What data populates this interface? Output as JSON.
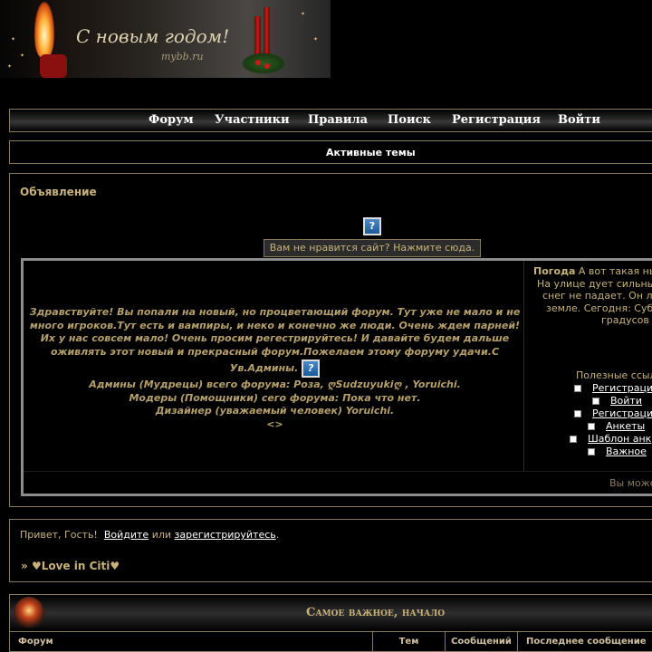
{
  "banner": {
    "greeting": "С новым годом!",
    "subtitle": "mybb.ru"
  },
  "nav": {
    "items": [
      "Форум",
      "Участники",
      "Правила",
      "Поиск",
      "Регистрация",
      "Войти"
    ]
  },
  "active_topics": "Активные темы",
  "announcement": {
    "title": "Объявление",
    "tooltip": "Вам не нравится сайт? Нажмите сюда.",
    "welcome_lines": [
      "Здравствуйте! Вы попали на новый, но процветающий форум. Тут уже не мало и не",
      "много игроков.Тут есть и вампиры, и неко и конечно же люди. Очень ждем парней!",
      "Их у нас совсем мало! Очень просим регестрируйтесь! И давайте будем дальше",
      "оживлять этот новый и прекрасный форум.Пожелаем этому форуму удачи.С",
      "Ув.Админы.",
      "Админы (Мудрецы) всего форума: Роза, ღSudzuyukiღ , Yoruichi.",
      "Модеры (Помощники) сего форума: Пока что нет.",
      "Дизайнер (уважаемый человек) Yoruichi.",
      "<>"
    ],
    "weather": {
      "label": "Погода",
      "lines": [
        "А вот такая ны",
        "На улице дует сильны",
        "снег не падает. Он лиш",
        "земле. Сегодня: Субб",
        "градусов"
      ]
    },
    "links_title": "Полезные ссыл",
    "links": [
      "Регистраци",
      "Войти",
      "Регистраци",
      "Анкеты",
      "Шаблон анк",
      "Важное"
    ],
    "footer": "Вы може"
  },
  "guest": {
    "greeting_prefix": "Привет, Гость!",
    "login_link": "Войдите",
    "or": "или",
    "register_link": "зарегистрируйтесь",
    "period": ".",
    "crumb_arrow": "»",
    "forum_name": "♥Love in Citi♥"
  },
  "category": {
    "title": "Самое важное, начало",
    "columns": [
      "Форум",
      "Тем",
      "Сообщений",
      "Последнее сообщение"
    ]
  }
}
